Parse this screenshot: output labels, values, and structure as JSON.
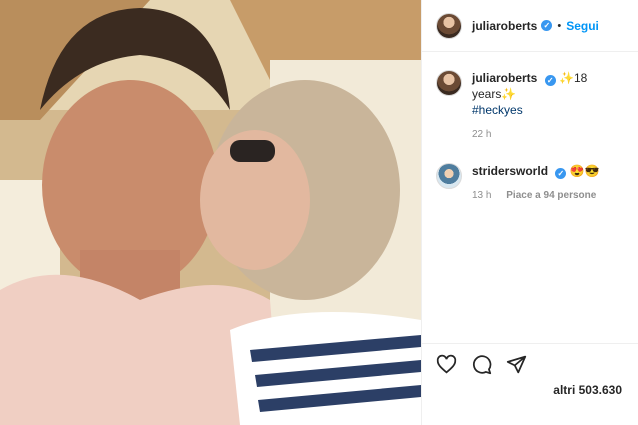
{
  "post": {
    "author": "juliaroberts",
    "follow_label": "Segui",
    "separator": "•",
    "verified_glyph": "✓"
  },
  "comments": [
    {
      "user": "juliaroberts",
      "text": "✨18 years✨",
      "hashtag": "#heckyes",
      "time": "22 h"
    },
    {
      "user": "stridersworld",
      "text": "😍😎",
      "time": "13 h",
      "likes": "Piace a 94 persone"
    }
  ],
  "actions": {
    "icons": [
      "heart-icon",
      "comment-icon",
      "share-icon"
    ]
  },
  "likes_label": "altri 503.630",
  "colors": {
    "accent": "#0095f6",
    "verified": "#3897f0",
    "text": "#262626",
    "muted": "#8e8e8e"
  }
}
